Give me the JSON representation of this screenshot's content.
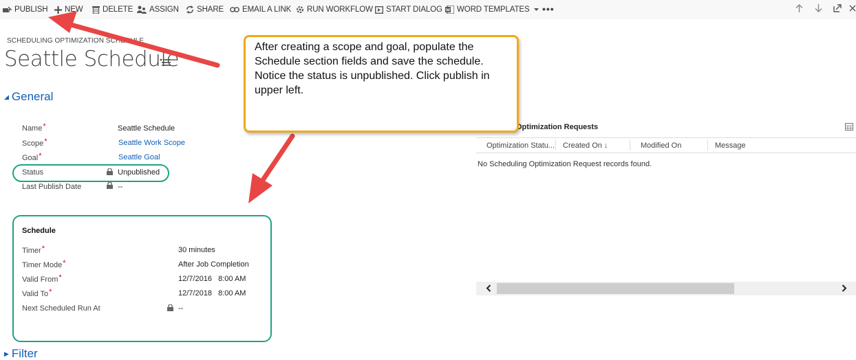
{
  "toolbar": {
    "publish": "PUBLISH",
    "new": "NEW",
    "delete": "DELETE",
    "assign": "ASSIGN",
    "share": "SHARE",
    "email_link": "EMAIL A LINK",
    "run_workflow": "RUN WORKFLOW",
    "start_dialog": "START DIALOG",
    "word_templates": "WORD TEMPLATES",
    "more": "•••"
  },
  "header": {
    "entity": "SCHEDULING OPTIMIZATION SCHEDULE",
    "title": "Seattle Schedule"
  },
  "general": {
    "heading": "General",
    "name_label": "Name",
    "name_value": "Seattle Schedule",
    "scope_label": "Scope",
    "scope_value": "Seattle Work Scope",
    "goal_label": "Goal",
    "goal_value": "Seattle Goal",
    "status_label": "Status",
    "status_value": "Unpublished",
    "last_publish_label": "Last Publish Date",
    "last_publish_value": "--"
  },
  "schedule": {
    "heading": "Schedule",
    "timer_label": "Timer",
    "timer_value": "30 minutes",
    "timer_mode_label": "Timer Mode",
    "timer_mode_value": "After Job Completion",
    "valid_from_label": "Valid From",
    "valid_from_value": "12/7/2016   8:00 AM",
    "valid_to_label": "Valid To",
    "valid_to_value": "12/7/2018   8:00 AM",
    "next_run_label": "Next Scheduled Run At",
    "next_run_value": "--"
  },
  "filter": {
    "heading": "Filter"
  },
  "callout": {
    "text": "After creating a scope and goal, populate the Schedule section fields and save the schedule.  Notice the status is unpublished. Click publish in upper left."
  },
  "subgrid": {
    "title": "Optimization Requests",
    "columns": [
      "Optimization Statu...",
      "Created On ↓",
      "Modified On",
      "Message"
    ],
    "empty_message": "No Scheduling Optimization Request records found."
  },
  "colors": {
    "link": "#1160b7",
    "highlight": "#1fa384",
    "callout_border": "#f0a81c",
    "arrow": "#e84545",
    "required": "#e0001b"
  }
}
